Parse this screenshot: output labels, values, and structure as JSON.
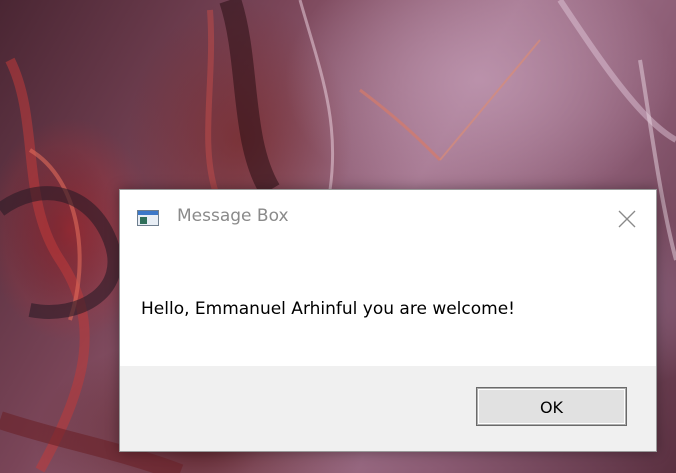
{
  "dialog": {
    "title": "Message Box",
    "message": "Hello, Emmanuel Arhinful you are welcome!",
    "ok_label": "OK",
    "close_icon": "close-icon",
    "app_icon": "window-app-icon"
  },
  "colors": {
    "dialog_background": "#ffffff",
    "footer_background": "#f0f0f0",
    "title_text": "#8a8a8a",
    "message_text": "#000000",
    "button_face": "#e1e1e1"
  }
}
